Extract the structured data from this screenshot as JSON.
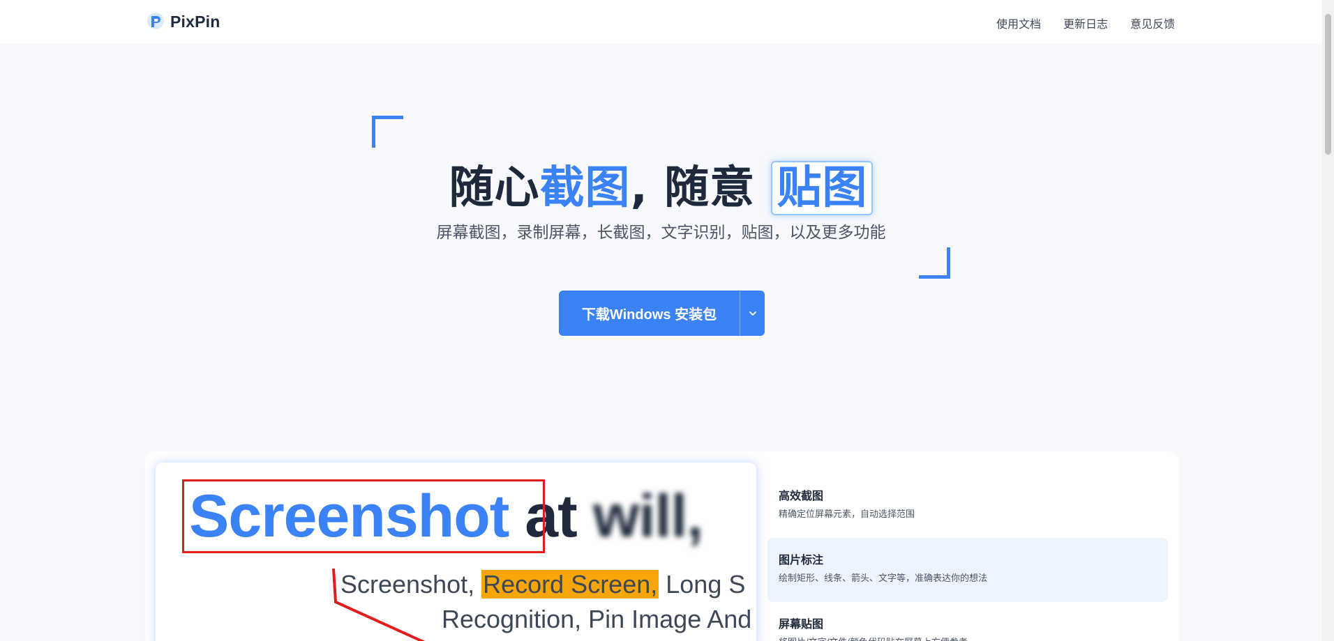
{
  "header": {
    "brand": "PixPin",
    "nav": [
      "使用文档",
      "更新日志",
      "意见反馈"
    ]
  },
  "hero": {
    "title_part1": "随心",
    "title_part2": "截图",
    "title_part3": ", 随意",
    "title_part4": "贴图",
    "subtitle": "屏幕截图，录制屏幕，长截图，文字识别，贴图，以及更多功能",
    "download_label": "下载Windows 安装包"
  },
  "preview": {
    "word_screenshot": "Screenshot",
    "word_at": " at ",
    "word_will": "will,",
    "line2_a": "Screenshot, ",
    "line2_highlight": "Record Screen,",
    "line2_b": " Long S",
    "line3": "Recognition, Pin Image And"
  },
  "features": [
    {
      "title": "高效截图",
      "desc": "精确定位屏幕元素，自动选择范围"
    },
    {
      "title": "图片标注",
      "desc": "绘制矩形、线条、箭头、文字等，准确表达你的想法"
    },
    {
      "title": "屏幕贴图",
      "desc": "将图片/文字/文件/颜色代码贴在屏幕上方便参考"
    }
  ],
  "colors": {
    "accent": "#3b82f6",
    "highlight": "#f6a609",
    "annotation": "#e11d1d"
  }
}
